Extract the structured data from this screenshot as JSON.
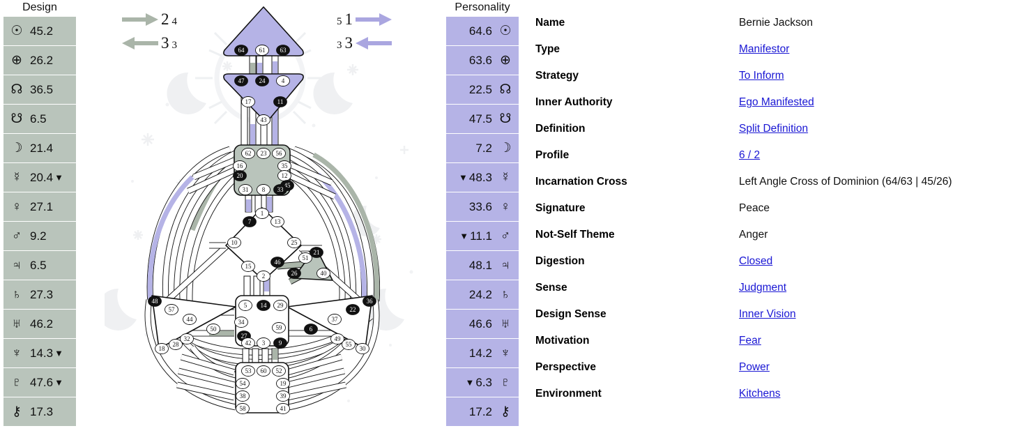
{
  "design": {
    "title": "Design",
    "rows": [
      {
        "glyph": "☉",
        "icon": "sun-icon",
        "value": "45.2",
        "retrograde": false
      },
      {
        "glyph": "⊕",
        "icon": "earth-icon",
        "value": "26.2",
        "retrograde": false
      },
      {
        "glyph": "☊",
        "icon": "north-node-icon",
        "value": "36.5",
        "retrograde": false
      },
      {
        "glyph": "☋",
        "icon": "south-node-icon",
        "value": "6.5",
        "retrograde": false
      },
      {
        "glyph": "☽",
        "icon": "moon-icon",
        "value": "21.4",
        "retrograde": false
      },
      {
        "glyph": "☿",
        "icon": "mercury-icon",
        "value": "20.4",
        "retrograde": true
      },
      {
        "glyph": "♀",
        "icon": "venus-icon",
        "value": "27.1",
        "retrograde": false
      },
      {
        "glyph": "♂",
        "icon": "mars-icon",
        "value": "9.2",
        "retrograde": false
      },
      {
        "glyph": "♃",
        "icon": "jupiter-icon",
        "value": "6.5",
        "retrograde": false
      },
      {
        "glyph": "♄",
        "icon": "saturn-icon",
        "value": "27.3",
        "retrograde": false
      },
      {
        "glyph": "♅",
        "icon": "uranus-icon",
        "value": "46.2",
        "retrograde": false
      },
      {
        "glyph": "♆",
        "icon": "neptune-icon",
        "value": "14.3",
        "retrograde": true
      },
      {
        "glyph": "♇",
        "icon": "pluto-icon",
        "value": "47.6",
        "retrograde": true
      },
      {
        "glyph": "⚷",
        "icon": "chiron-icon",
        "value": "17.3",
        "retrograde": false
      }
    ]
  },
  "personality": {
    "title": "Personality",
    "rows": [
      {
        "glyph": "☉",
        "icon": "sun-icon",
        "value": "64.6",
        "retrograde": false
      },
      {
        "glyph": "⊕",
        "icon": "earth-icon",
        "value": "63.6",
        "retrograde": false
      },
      {
        "glyph": "☊",
        "icon": "north-node-icon",
        "value": "22.5",
        "retrograde": false
      },
      {
        "glyph": "☋",
        "icon": "south-node-icon",
        "value": "47.5",
        "retrograde": false
      },
      {
        "glyph": "☽",
        "icon": "moon-icon",
        "value": "7.2",
        "retrograde": false
      },
      {
        "glyph": "☿",
        "icon": "mercury-icon",
        "value": "48.3",
        "retrograde": true
      },
      {
        "glyph": "♀",
        "icon": "venus-icon",
        "value": "33.6",
        "retrograde": false
      },
      {
        "glyph": "♂",
        "icon": "mars-icon",
        "value": "11.1",
        "retrograde": true
      },
      {
        "glyph": "♃",
        "icon": "jupiter-icon",
        "value": "48.1",
        "retrograde": false
      },
      {
        "glyph": "♄",
        "icon": "saturn-icon",
        "value": "24.2",
        "retrograde": false
      },
      {
        "glyph": "♅",
        "icon": "uranus-icon",
        "value": "46.6",
        "retrograde": false
      },
      {
        "glyph": "♆",
        "icon": "neptune-icon",
        "value": "14.2",
        "retrograde": false
      },
      {
        "glyph": "♇",
        "icon": "pluto-icon",
        "value": "6.3",
        "retrograde": true
      },
      {
        "glyph": "⚷",
        "icon": "chiron-icon",
        "value": "17.2",
        "retrograde": false
      }
    ]
  },
  "variables": {
    "design_top": {
      "big": "2",
      "small": "4",
      "direction": "right"
    },
    "design_bottom": {
      "big": "3",
      "small": "3",
      "direction": "left"
    },
    "personality_top": {
      "big": "1",
      "small": "5",
      "direction": "right"
    },
    "personality_bottom": {
      "big": "3",
      "small": "3",
      "direction": "left"
    }
  },
  "properties": [
    {
      "label": "Name",
      "value": "Bernie Jackson",
      "link": false
    },
    {
      "label": "Type",
      "value": "Manifestor",
      "link": true
    },
    {
      "label": "Strategy",
      "value": "To Inform",
      "link": true
    },
    {
      "label": "Inner Authority",
      "value": "Ego Manifested",
      "link": true
    },
    {
      "label": "Definition",
      "value": "Split Definition",
      "link": true
    },
    {
      "label": "Profile",
      "value": "6 / 2",
      "link": true
    },
    {
      "label": "Incarnation Cross",
      "value": "Left Angle Cross of Dominion (64/63 | 45/26)",
      "link": false
    },
    {
      "label": "Signature",
      "value": "Peace",
      "link": false
    },
    {
      "label": "Not-Self Theme",
      "value": "Anger",
      "link": false
    },
    {
      "label": "Digestion",
      "value": "Closed",
      "link": true
    },
    {
      "label": "Sense",
      "value": "Judgment",
      "link": true
    },
    {
      "label": "Design Sense",
      "value": "Inner Vision",
      "link": true
    },
    {
      "label": "Motivation",
      "value": "Fear",
      "link": true
    },
    {
      "label": "Perspective",
      "value": "Power",
      "link": true
    },
    {
      "label": "Environment",
      "value": "Kitchens",
      "link": true
    }
  ],
  "colors": {
    "design": "#b9c4bb",
    "personality": "#b5b3e6",
    "link": "#1a17d4",
    "defined_gate": "#111111",
    "undefined_gate": "#ffffff",
    "center_line": "#111111",
    "watermark": "#eff0f2"
  },
  "bodygraph": {
    "centers": [
      {
        "name": "head",
        "defined": true,
        "fill": "#b5b3e6"
      },
      {
        "name": "ajna",
        "defined": true,
        "fill": "#b5b3e6"
      },
      {
        "name": "throat",
        "defined": true,
        "fill": "#b9c4bb"
      },
      {
        "name": "g-center",
        "defined": false,
        "fill": "#ffffff"
      },
      {
        "name": "heart-ego",
        "defined": true,
        "fill": "#b9c4bb"
      },
      {
        "name": "spleen",
        "defined": false,
        "fill": "#ffffff"
      },
      {
        "name": "solar-plexus",
        "defined": false,
        "fill": "#ffffff"
      },
      {
        "name": "sacral",
        "defined": false,
        "fill": "#ffffff"
      },
      {
        "name": "root",
        "defined": false,
        "fill": "#ffffff"
      }
    ],
    "gates": {
      "head": [
        {
          "n": "64",
          "on": true
        },
        {
          "n": "61",
          "on": false
        },
        {
          "n": "63",
          "on": true
        }
      ],
      "ajna": [
        {
          "n": "47",
          "on": true
        },
        {
          "n": "24",
          "on": true
        },
        {
          "n": "4",
          "on": false
        },
        {
          "n": "17",
          "on": false
        },
        {
          "n": "11",
          "on": true
        },
        {
          "n": "43",
          "on": false
        }
      ],
      "throat": [
        {
          "n": "62",
          "on": false
        },
        {
          "n": "23",
          "on": false
        },
        {
          "n": "56",
          "on": false
        },
        {
          "n": "16",
          "on": false
        },
        {
          "n": "35",
          "on": false
        },
        {
          "n": "20",
          "on": true
        },
        {
          "n": "12",
          "on": false
        },
        {
          "n": "45",
          "on": true
        },
        {
          "n": "31",
          "on": false
        },
        {
          "n": "8",
          "on": false
        },
        {
          "n": "33",
          "on": true
        }
      ],
      "g-center": [
        {
          "n": "1",
          "on": false
        },
        {
          "n": "7",
          "on": true
        },
        {
          "n": "13",
          "on": false
        },
        {
          "n": "10",
          "on": false
        },
        {
          "n": "25",
          "on": false
        },
        {
          "n": "15",
          "on": false
        },
        {
          "n": "46",
          "on": true
        },
        {
          "n": "2",
          "on": false
        }
      ],
      "heart-ego": [
        {
          "n": "21",
          "on": true
        },
        {
          "n": "51",
          "on": false
        },
        {
          "n": "26",
          "on": true
        },
        {
          "n": "40",
          "on": false
        }
      ],
      "spleen": [
        {
          "n": "48",
          "on": true
        },
        {
          "n": "57",
          "on": false
        },
        {
          "n": "44",
          "on": false
        },
        {
          "n": "50",
          "on": false
        },
        {
          "n": "32",
          "on": false
        },
        {
          "n": "28",
          "on": false
        },
        {
          "n": "18",
          "on": false
        }
      ],
      "solar-plexus": [
        {
          "n": "36",
          "on": true
        },
        {
          "n": "22",
          "on": true
        },
        {
          "n": "37",
          "on": false
        },
        {
          "n": "6",
          "on": true
        },
        {
          "n": "49",
          "on": false
        },
        {
          "n": "55",
          "on": false
        },
        {
          "n": "30",
          "on": false
        }
      ],
      "sacral": [
        {
          "n": "5",
          "on": false
        },
        {
          "n": "14",
          "on": true
        },
        {
          "n": "29",
          "on": false
        },
        {
          "n": "34",
          "on": false
        },
        {
          "n": "27",
          "on": true
        },
        {
          "n": "59",
          "on": false
        },
        {
          "n": "42",
          "on": false
        },
        {
          "n": "3",
          "on": false
        },
        {
          "n": "9",
          "on": true
        }
      ],
      "root": [
        {
          "n": "53",
          "on": false
        },
        {
          "n": "60",
          "on": false
        },
        {
          "n": "52",
          "on": false
        },
        {
          "n": "54",
          "on": false
        },
        {
          "n": "19",
          "on": false
        },
        {
          "n": "38",
          "on": false
        },
        {
          "n": "39",
          "on": false
        },
        {
          "n": "58",
          "on": false
        },
        {
          "n": "41",
          "on": false
        }
      ]
    }
  }
}
